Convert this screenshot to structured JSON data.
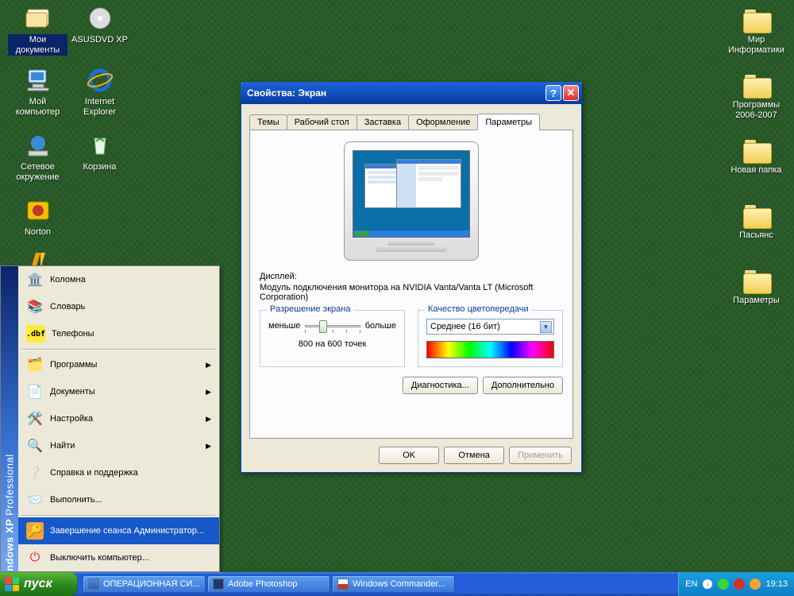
{
  "desktop": {
    "icons_left": [
      {
        "name": "my-documents",
        "label": "Мои документы"
      },
      {
        "name": "asusdvd",
        "label": "ASUSDVD XP"
      },
      {
        "name": "my-computer",
        "label": "Мой компьютер"
      },
      {
        "name": "internet-explorer",
        "label": "Internet Explorer"
      },
      {
        "name": "network-places",
        "label": "Сетевое окружение"
      },
      {
        "name": "recycle-bin",
        "label": "Корзина"
      },
      {
        "name": "norton",
        "label": "Norton"
      },
      {
        "name": "winamp",
        "label": ""
      }
    ],
    "icons_right": [
      {
        "name": "folder-world-it",
        "label": "Мир Информатики"
      },
      {
        "name": "folder-programs",
        "label": "Программы 2006-2007"
      },
      {
        "name": "folder-new",
        "label": "Новая папка"
      },
      {
        "name": "folder-solitaire",
        "label": "Пасьянс"
      },
      {
        "name": "folder-params",
        "label": "Параметры"
      }
    ]
  },
  "start_menu": {
    "band_bold": "Windows XP",
    "band_light": "Professional",
    "items_top": [
      {
        "name": "kolomna",
        "label": "Коломна",
        "icon": "🏛️"
      },
      {
        "name": "dictionary",
        "label": "Словарь",
        "icon": "📚"
      },
      {
        "name": "phones",
        "label": "Телефоны",
        "icon": "💾"
      }
    ],
    "items_main": [
      {
        "name": "programs",
        "label": "Программы",
        "icon": "📋",
        "sub": true
      },
      {
        "name": "documents",
        "label": "Документы",
        "icon": "📄",
        "sub": true
      },
      {
        "name": "settings",
        "label": "Настройка",
        "icon": "🛠️",
        "sub": true
      },
      {
        "name": "find",
        "label": "Найти",
        "icon": "🔍",
        "sub": true
      },
      {
        "name": "help",
        "label": "Справка и поддержка",
        "icon": "❓",
        "sub": false
      },
      {
        "name": "run",
        "label": "Выполнить...",
        "icon": "▶️",
        "sub": false
      }
    ],
    "items_bottom": [
      {
        "name": "logoff",
        "label": "Завершение сеанса Администратор...",
        "icon": "🔑",
        "hover": true
      },
      {
        "name": "shutdown",
        "label": "Выключить компьютер...",
        "icon": "⭕",
        "hover": false
      }
    ]
  },
  "dialog": {
    "title": "Свойства: Экран",
    "tabs": [
      {
        "name": "themes",
        "label": "Темы"
      },
      {
        "name": "desktop",
        "label": "Рабочий стол"
      },
      {
        "name": "screensaver",
        "label": "Заставка"
      },
      {
        "name": "appearance",
        "label": "Оформление"
      },
      {
        "name": "settings",
        "label": "Параметры",
        "active": true
      }
    ],
    "display_label": "Дисплей:",
    "display_text": "Модуль подключения монитора на NVIDIA Vanta/Vanta LT (Microsoft Corporation)",
    "resolution_legend": "Разрешение экрана",
    "res_less": "меньше",
    "res_more": "больше",
    "res_value": "800 на 600 точек",
    "color_legend": "Качество цветопередачи",
    "color_value": "Среднее (16 бит)",
    "btn_diag": "Диагностика...",
    "btn_adv": "Дополнительно",
    "btn_ok": "OK",
    "btn_cancel": "Отмена",
    "btn_apply": "Применить"
  },
  "taskbar": {
    "start": "пуск",
    "tasks": [
      {
        "name": "task-word",
        "label": "ОПЕРАЦИОННАЯ СИ..."
      },
      {
        "name": "task-ps",
        "label": "Adobe Photoshop"
      },
      {
        "name": "task-wincmd",
        "label": "Windows Commander..."
      }
    ],
    "lang": "EN",
    "clock": "19:13"
  }
}
